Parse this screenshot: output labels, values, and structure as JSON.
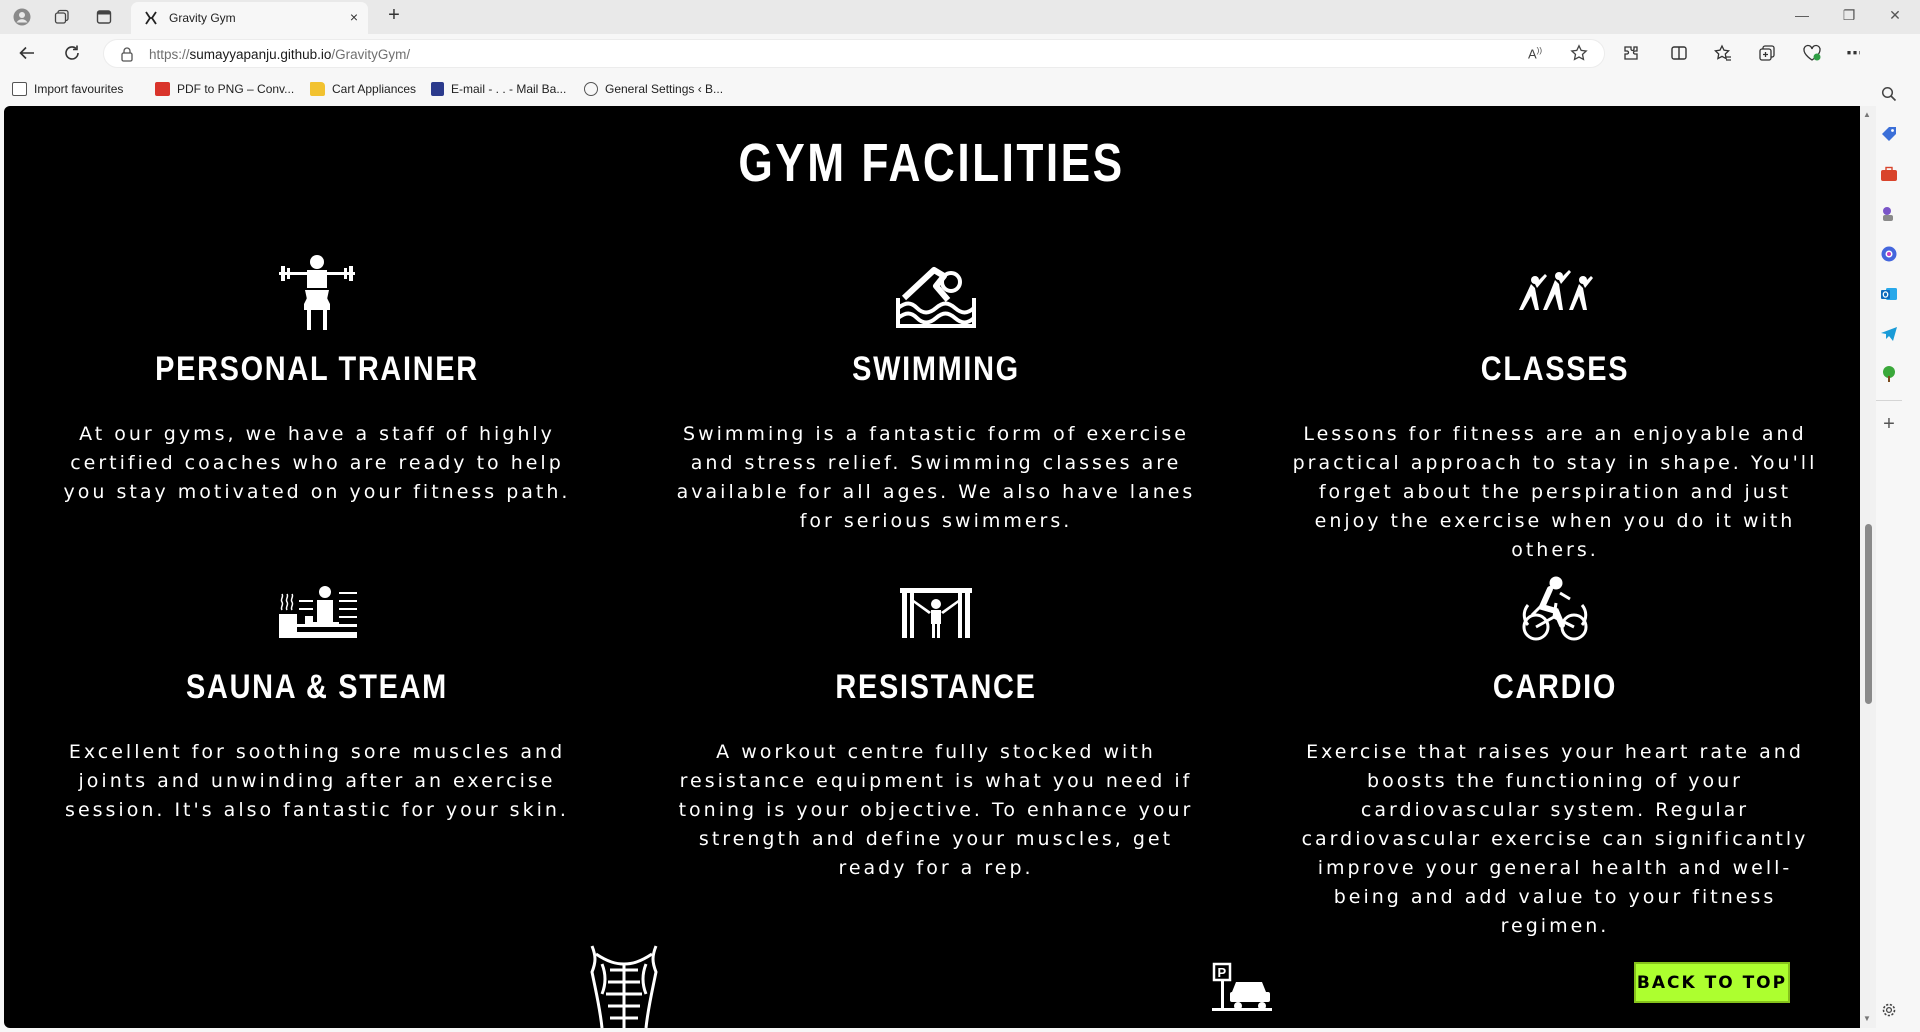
{
  "browser": {
    "tab_title": "Gravity Gym",
    "tab_close": "×",
    "new_tab": "+",
    "url_scheme": "https://",
    "url_host": "sumayyapanju.github.io",
    "url_path": "/GravityGym/",
    "window_min": "—",
    "window_restore": "❐",
    "window_close": "✕"
  },
  "bookmarks": [
    {
      "label": "Import favourites",
      "icon": "import-icon",
      "color": "#555555"
    },
    {
      "label": "PDF to PNG – Conv...",
      "icon": "pdf-icon",
      "color": "#d9342b"
    },
    {
      "label": "Cart Appliances",
      "icon": "folder-icon",
      "color": "#f2c230"
    },
    {
      "label": "E-mail - . . - Mail Ba...",
      "icon": "mail-icon",
      "color": "#2b3a8c"
    },
    {
      "label": "General Settings ‹ B...",
      "icon": "wordpress-icon",
      "color": "#555555"
    }
  ],
  "page": {
    "title": "GYM FACILITIES",
    "facilities": [
      {
        "title": "PERSONAL TRAINER",
        "icon": "trainer-icon",
        "desc": "At our gyms, we have a staff of highly certified coaches who are ready to help you stay motivated on your fitness path."
      },
      {
        "title": "SWIMMING",
        "icon": "swimming-icon",
        "desc": "Swimming is a fantastic form of exercise and stress relief. Swimming classes are available for all ages. We also have lanes for serious swimmers."
      },
      {
        "title": "CLASSES",
        "icon": "classes-icon",
        "desc": "Lessons for fitness are an enjoyable and practical approach to stay in shape. You'll forget about the perspiration and just enjoy the exercise when you do it with others."
      },
      {
        "title": "SAUNA & STEAM",
        "icon": "sauna-icon",
        "desc": "Excellent for soothing sore muscles and joints and unwinding after an exercise session. It's also fantastic for your skin."
      },
      {
        "title": "RESISTANCE",
        "icon": "resistance-icon",
        "desc": "A workout centre fully stocked with resistance equipment is what you need if toning is your objective. To enhance your strength and define your muscles, get ready for a rep."
      },
      {
        "title": "CARDIO",
        "icon": "cardio-icon",
        "desc": "Exercise that raises your heart rate and boosts the functioning of your cardiovascular system. Regular cardiovascular exercise can significantly improve your general health and well-being and add value to your fitness regimen."
      }
    ],
    "back_to_top": "BACK TO TOP",
    "accent_color": "#adff2f"
  }
}
